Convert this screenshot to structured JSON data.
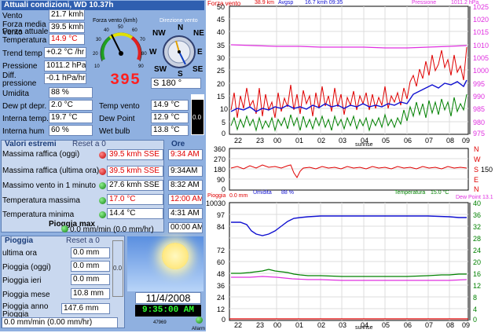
{
  "title": "Attuali condizioni, WD 10.37h",
  "current": {
    "rows": [
      {
        "label": "Vento",
        "value": "21.7 kmh"
      },
      {
        "label": "Forza media Vento",
        "value": "39.5 kmh"
      },
      {
        "label": "Forza attuale",
        "value": ""
      },
      {
        "label": "Temperatura",
        "value": "14.9 °C"
      },
      {
        "label": "Trend temp",
        "value": "+0.2 °C /hr"
      },
      {
        "label": "Pressione",
        "value": "1011.2 hPa"
      },
      {
        "label": "Diff. pressione",
        "value": "-0.1 hPa/hr"
      },
      {
        "label": "Umidita",
        "value": "88 %"
      },
      {
        "label": "Dew pt depr.",
        "value": "2.0 °C"
      },
      {
        "label": "Interna temp.",
        "value": "19.7 °C"
      },
      {
        "label": "Interna hum",
        "value": "60 %"
      }
    ],
    "gauge_title": "Forza vento (kmh)",
    "gauge_value": "395",
    "gauge_ticks": [
      "0",
      "10",
      "20",
      "30",
      "40",
      "50",
      "60",
      "70",
      "80",
      "90",
      "100"
    ],
    "compass_title": "Direzione vento",
    "compass": {
      "N": "N",
      "NE": "NE",
      "E": "E",
      "SE": "SE",
      "S": "S",
      "SW": "SW",
      "W": "W",
      "NW": "NW"
    },
    "direction": "S  180 °",
    "right_rows": [
      {
        "label": "Temp vento",
        "value": "14.9 °C"
      },
      {
        "label": "Dew Point",
        "value": "12.9 °C"
      },
      {
        "label": "Wet bulb",
        "value": "13.8 °C"
      }
    ],
    "thermo_value": "0.0"
  },
  "extremes": {
    "title": "Valori estremi",
    "reset": "Reset a 0",
    "ore": "Ore",
    "rows": [
      {
        "label": "Massima raffica (oggi)",
        "value": "39.5 kmh SSE",
        "time": "9:34 AM",
        "red": true
      },
      {
        "label": "Massima raffica (ultima ora)",
        "value": "39.5 kmh SSE",
        "time": "9:34AM",
        "red": false
      },
      {
        "label": "Massimo vento in 1 minuto",
        "value": "27.6 kmh SSE",
        "time": "8:32 AM",
        "red": false
      },
      {
        "label": "Temperatura massima",
        "value": "17.0 °C",
        "time": "12:00 AM",
        "red": true
      },
      {
        "label": "Temperatura minima",
        "value": "14.4 °C",
        "time": "4:31 AM",
        "red": false
      }
    ],
    "rain_max_label": "Pioggia max",
    "rain_max_value": "0.0 mm/min (0.0 mm/hr)",
    "rain_max_time": "00:00 AM"
  },
  "rain": {
    "title": "Pioggia",
    "reset": "Reset a 0",
    "rows": [
      {
        "label": "ultima ora",
        "value": "0.0 mm"
      },
      {
        "label": "Pioggia (oggi)",
        "value": "0.0 mm"
      },
      {
        "label": "Pioggia ieri",
        "value": "0.0 mm"
      },
      {
        "label": "Pioggia mese",
        "value": "10.8 mm"
      },
      {
        "label": "Pioggia anno",
        "value": "147.6 mm"
      }
    ],
    "pioggia_label": "Pioggia",
    "rate": "0.0 mm/min (0.00 mm/hr)",
    "thermo_value": "0.0"
  },
  "clock": {
    "date": "11/4/2008",
    "time": "9:35:00 AM",
    "counter": "47969",
    "alarm": "Allarm"
  },
  "charts": {
    "top": {
      "hdr_left": "Forza vento",
      "hdr_mid1": "38.9 km",
      "hdr_mid2": "Avgsp",
      "hdr_mid3": "16.7 kmh  09:35",
      "hdr_press": "Pressione",
      "hdr_pval": "1011.2 hPa",
      "left_ticks": [
        "50",
        "45",
        "40",
        "35",
        "30",
        "25",
        "20",
        "15",
        "10",
        "5",
        "0"
      ],
      "right_ticks": [
        "1025",
        "1020",
        "1015",
        "1010",
        "1005",
        "1000",
        "995",
        "990",
        "985",
        "980",
        "975"
      ],
      "x_ticks": [
        "22",
        "23",
        "00",
        "01",
        "02",
        "03",
        "04",
        "05",
        "06",
        "07",
        "08",
        "09"
      ],
      "x_label": "sunrise"
    },
    "mid": {
      "left_ticks": [
        "360",
        "270",
        "180",
        "90",
        "0"
      ],
      "right_labels": [
        "N",
        "W",
        "S",
        "E",
        "N"
      ],
      "right_val": "150"
    },
    "bottom": {
      "hdr_left": "Pioggia",
      "hdr_lval": "0.0 mm",
      "hdr_hum": "Umidita",
      "hdr_hval": "88 %",
      "hdr_temp": "Temperatura",
      "hdr_tval": "15.0 °C",
      "hdr_dew": "Dew Point",
      "hdr_dval": "13.1",
      "left_ticks": [
        "10030",
        "97",
        "84",
        "72",
        "60",
        "48",
        "36",
        "24",
        "12",
        "0"
      ],
      "right_ticks": [
        "40",
        "36",
        "32",
        "28",
        "24",
        "20",
        "16",
        "12",
        "8",
        "4",
        "0"
      ],
      "x_ticks": [
        "22",
        "23",
        "00",
        "01",
        "02",
        "03",
        "04",
        "05",
        "06",
        "07",
        "08",
        "09"
      ],
      "x_label": "sunrise"
    }
  },
  "colors": {
    "panel": "#8fb0e0",
    "red": "#e00000",
    "blue": "#1010d0",
    "green": "#008000",
    "magenta": "#e030e0"
  }
}
